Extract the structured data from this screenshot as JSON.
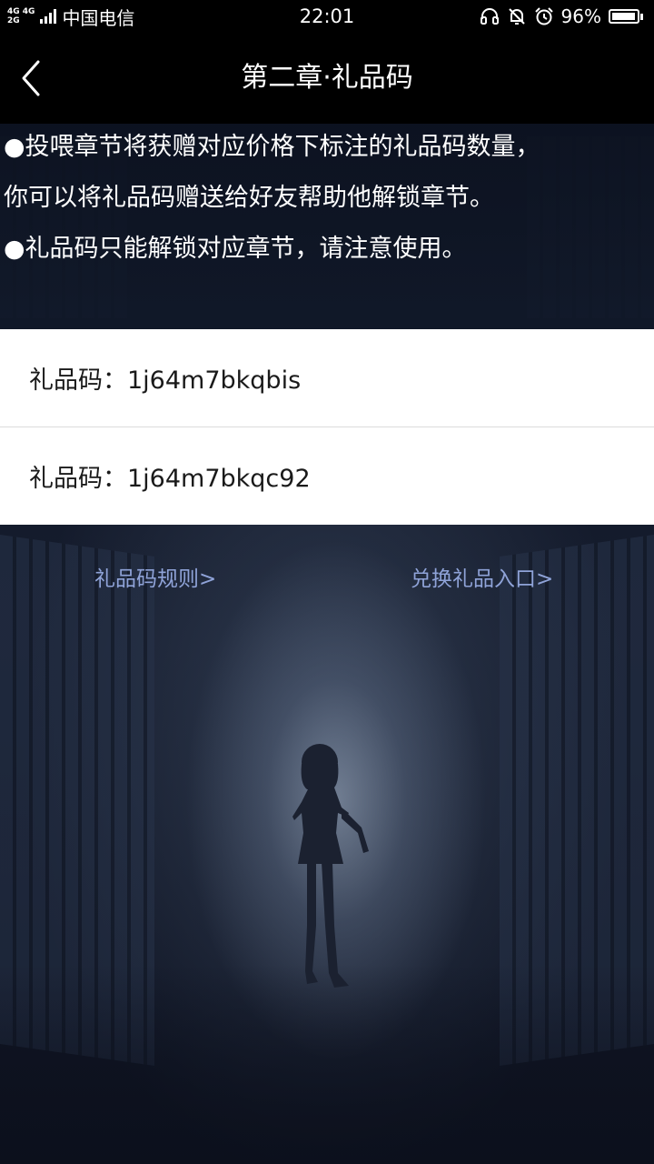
{
  "status_bar": {
    "network_top": "4G 4G",
    "network_bottom": "2G",
    "carrier": "中国电信",
    "time": "22:01",
    "battery_text": "96%",
    "battery_level": 0.96,
    "icons": [
      "headset-icon",
      "bell-muted-icon",
      "alarm-icon"
    ]
  },
  "header": {
    "title": "第二章·礼品码",
    "back_icon": "chevron-left-icon"
  },
  "notice": {
    "line1": "●投喂章节将获赠对应价格下标注的礼品码数量，",
    "line2": "你可以将礼品码赠送给好友帮助他解锁章节。",
    "line3": "●礼品码只能解锁对应章节，请注意使用。"
  },
  "codes": [
    {
      "text": "礼品码：1j64m7bkqbis"
    },
    {
      "text": "礼品码：1j64m7bkqc92"
    }
  ],
  "links": {
    "rules": "礼品码规则>",
    "redeem": "兑换礼品入口>"
  },
  "colors": {
    "link": "#8fa3d8",
    "bar": "#000000",
    "list_bg": "#ffffff"
  }
}
